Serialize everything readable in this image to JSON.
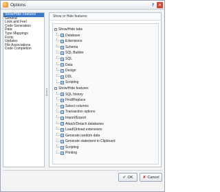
{
  "window": {
    "title": "Options",
    "help_glyph": "?",
    "close_glyph": "✕"
  },
  "nav": {
    "items": [
      "Show/Hide Features",
      "General",
      "Look and Feel",
      "Code Generation",
      "Data",
      "Type Mappings",
      "Fonts",
      "Updates",
      "File Associations",
      "Code Completion"
    ],
    "selected_index": 0
  },
  "content": {
    "header": "Show or Hide features",
    "groups": [
      {
        "label": "Show/Hide tabs",
        "expander": "−",
        "items": [
          "Database",
          "Extensions",
          "Schema",
          "SQL Builder",
          "SQL",
          "Data",
          "Design",
          "DDL",
          "Scripting"
        ]
      },
      {
        "label": "Show/Hide features",
        "expander": "−",
        "items": [
          "SQL history",
          "Find/Replace",
          "Select columns",
          "Transaction options",
          "Import/Export",
          "Attach/Detach databases",
          "Load/Unload extensions",
          "Generate random data",
          "Generate statement to Clipboard",
          "Scripting",
          "Printing"
        ]
      }
    ]
  },
  "footer": {
    "ok": {
      "label": "OK",
      "icon": "✔"
    },
    "cancel": {
      "label": "Cancel",
      "icon": "✘"
    }
  },
  "colors": {
    "selection": "#3a78c9",
    "checkbox_fill": "#dbe6f4"
  },
  "icons": {
    "app": "app-options-icon",
    "help": "help-icon",
    "close": "close-icon",
    "ok": "checkmark-icon",
    "cancel": "cancel-x-icon"
  }
}
